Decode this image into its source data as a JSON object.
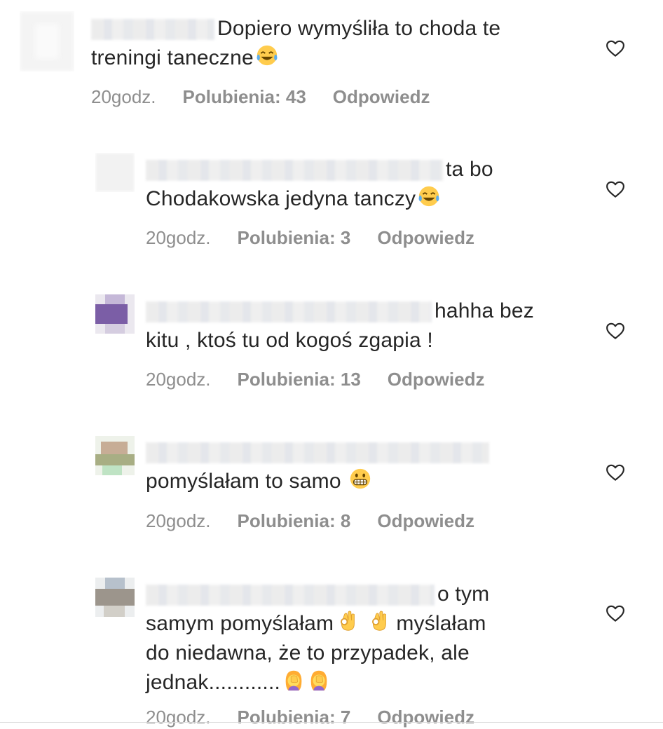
{
  "comments": [
    {
      "text_line1": "Dopiero wymyśliła to choda te",
      "text_line2": "treningi taneczne",
      "time": "20godz.",
      "likes": "Polubienia: 43",
      "reply": "Odpowiedz"
    },
    {
      "text_line1": "ta bo",
      "text_line2": "Chodakowska jedyna tanczy",
      "time": "20godz.",
      "likes": "Polubienia: 3",
      "reply": "Odpowiedz"
    },
    {
      "text_line1": "hahha bez",
      "text_line2": "kitu , ktoś tu od kogoś zgapia !",
      "time": "20godz.",
      "likes": "Polubienia: 13",
      "reply": "Odpowiedz"
    },
    {
      "text_line1": "pomyślałam to samo",
      "time": "20godz.",
      "likes": "Polubienia: 8",
      "reply": "Odpowiedz"
    },
    {
      "text_line1": "o tym",
      "text_line2a": "samym pomyślałam",
      "text_line2b": "myślałam",
      "text_line3": "do niedawna, że to przypadek, ale",
      "text_line4": "jednak............",
      "time": "20godz.",
      "likes": "Polubienia: 7",
      "reply": "Odpowiedz"
    }
  ],
  "icons": {
    "like": "heart-outline-icon",
    "laugh": "tears-of-joy-emoji",
    "grimace": "grimacing-emoji",
    "ok": "ok-hand-emoji",
    "facepalm": "facepalm-emoji"
  },
  "colors": {
    "text": "#262626",
    "meta": "#8e8e8e"
  }
}
